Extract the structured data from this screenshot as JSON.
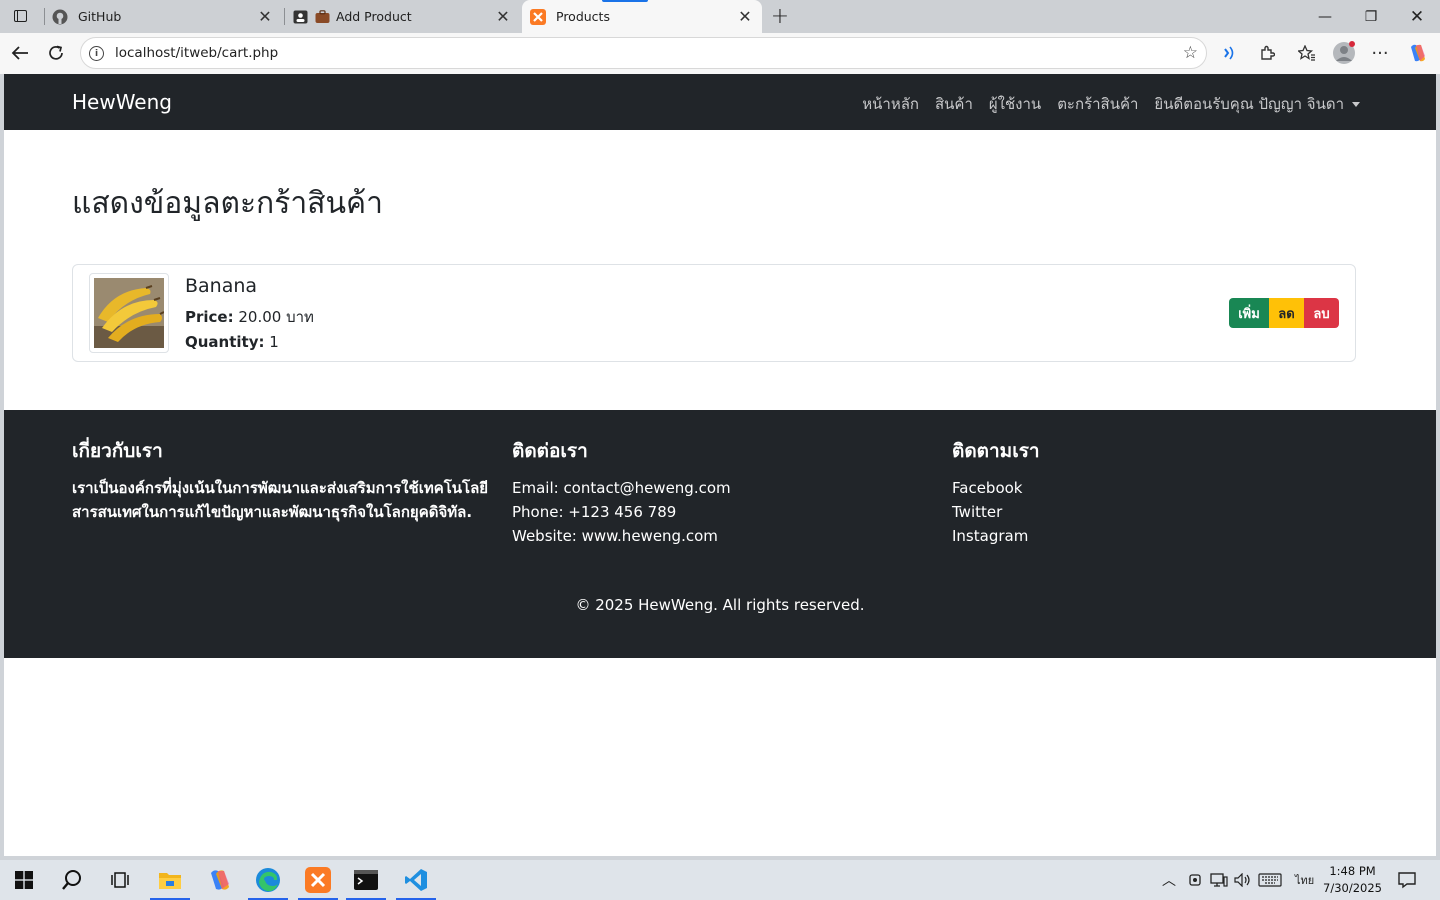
{
  "browser": {
    "tabs": [
      {
        "title": "GitHub",
        "icon": "github-icon"
      },
      {
        "title": "Add Product",
        "icon": "briefcase-icon"
      },
      {
        "title": "Products",
        "icon": "xampp-icon",
        "active": true
      }
    ],
    "url": "localhost/itweb/cart.php"
  },
  "site": {
    "brand": "HewWeng",
    "nav": [
      "หน้าหลัก",
      "สินค้า",
      "ผู้ใช้งาน",
      "ตะกร้าสินค้า",
      "ยินดีตอนรับคุณ ปัญญา จินดา"
    ]
  },
  "page": {
    "title": "แสดงข้อมูลตะกร้าสินค้า"
  },
  "cart": {
    "items": [
      {
        "name": "Banana",
        "price_label": "Price:",
        "price_value": "20.00 บาท",
        "qty_label": "Quantity:",
        "qty_value": "1",
        "buttons": {
          "add": "เพิ่ม",
          "decrease": "ลด",
          "remove": "ลบ"
        }
      }
    ]
  },
  "footer": {
    "about_title": "เกี่ยวกับเรา",
    "about_text": "เราเป็นองค์กรที่มุ่งเน้นในการพัฒนาและส่งเสริมการใช้เทคโนโลยีสารสนเทศในการแก้ไขปัญหาและพัฒนาธุรกิจในโลกยุคดิจิทัล.",
    "contact_title": "ติดต่อเรา",
    "contact_email": "Email: contact@heweng.com",
    "contact_phone": "Phone: +123 456 789",
    "contact_web": "Website: www.heweng.com",
    "follow_title": "ติดตามเรา",
    "follow_links": [
      "Facebook",
      "Twitter",
      "Instagram"
    ],
    "copyright": "© 2025 HewWeng. All rights reserved."
  },
  "taskbar": {
    "lang": "ไทย",
    "time": "1:48 PM",
    "date": "7/30/2025"
  },
  "colors": {
    "navbar": "#212529",
    "btn_add": "#198754",
    "btn_decrease": "#ffc107",
    "btn_remove": "#dc3545"
  }
}
